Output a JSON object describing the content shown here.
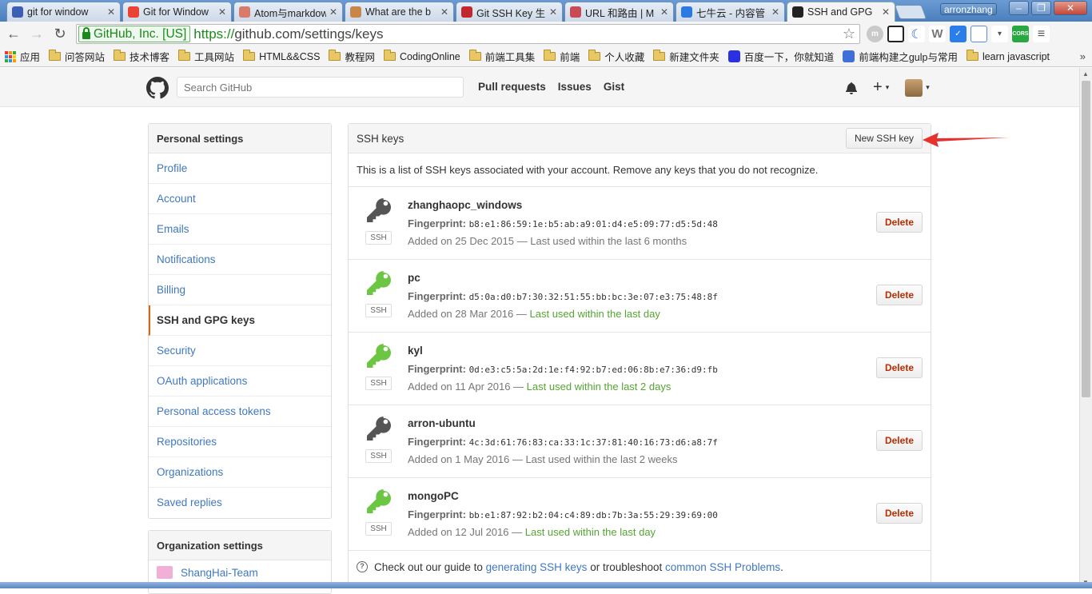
{
  "browser": {
    "tabs": [
      {
        "title": "git for window",
        "fav_color": "#3a5fb4"
      },
      {
        "title": "Git for Window",
        "fav_color": "#ea4335"
      },
      {
        "title": "Atom与markdown",
        "fav_color": "#d97b6a"
      },
      {
        "title": "What are the b",
        "fav_color": "#c9864a"
      },
      {
        "title": "Git SSH Key 生",
        "fav_color": "#c1272d"
      },
      {
        "title": "URL 和路由 | M",
        "fav_color": "#c84a55"
      },
      {
        "title": "七牛云 - 内容管",
        "fav_color": "#2a7ae2"
      },
      {
        "title": "SSH and GPG",
        "fav_color": "#222222"
      }
    ],
    "profile_name": "arronzhang",
    "url_ev_label": "GitHub, Inc. [US]",
    "url_scheme": "https://",
    "url_rest": "github.com/settings/keys",
    "bookmarks": [
      {
        "label": "应用",
        "type": "apps"
      },
      {
        "label": "问答网站",
        "type": "folder"
      },
      {
        "label": "技术博客",
        "type": "folder"
      },
      {
        "label": "工具网站",
        "type": "folder"
      },
      {
        "label": "HTML&&CSS",
        "type": "folder"
      },
      {
        "label": "教程网",
        "type": "folder"
      },
      {
        "label": "CodingOnline",
        "type": "folder"
      },
      {
        "label": "前端工具集",
        "type": "folder"
      },
      {
        "label": "前端",
        "type": "folder"
      },
      {
        "label": "个人收藏",
        "type": "folder"
      },
      {
        "label": "新建文件夹",
        "type": "folder"
      },
      {
        "label": "百度一下，你就知道",
        "type": "baidu"
      },
      {
        "label": "前端构建之gulp与常用",
        "type": "page"
      },
      {
        "label": "learn javascript",
        "type": "folder"
      }
    ],
    "bookmarks_more": "»"
  },
  "header": {
    "search_placeholder": "Search GitHub",
    "nav": [
      "Pull requests",
      "Issues",
      "Gist"
    ],
    "plus_label": "+",
    "caret": "▾"
  },
  "personal_settings": {
    "title": "Personal settings",
    "items": [
      "Profile",
      "Account",
      "Emails",
      "Notifications",
      "Billing",
      "SSH and GPG keys",
      "Security",
      "OAuth applications",
      "Personal access tokens",
      "Repositories",
      "Organizations",
      "Saved replies"
    ],
    "selected_index": 5
  },
  "organization_settings": {
    "title": "Organization settings",
    "orgs": [
      "ShangHai-Team"
    ]
  },
  "ssh": {
    "title": "SSH keys",
    "new_button": "New SSH key",
    "description": "This is a list of SSH keys associated with your account. Remove any keys that you do not recognize.",
    "badge": "SSH",
    "fingerprint_label": "Fingerprint:",
    "delete_label": "Delete",
    "keys": [
      {
        "title": "zhanghaopc_windows",
        "fingerprint": "b8:e1:86:59:1e:b5:ab:a9:01:d4:e5:09:77:d5:5d:48",
        "added": "Added on 25 Dec 2015 —",
        "last_used": "Last used within the last 6 months",
        "recent": false,
        "key_color": "#555555"
      },
      {
        "title": "pc",
        "fingerprint": "d5:0a:d0:b7:30:32:51:55:bb:bc:3e:07:e3:75:48:8f",
        "added": "Added on 28 Mar 2016 —",
        "last_used": "Last used within the last day",
        "recent": true,
        "key_color": "#6cc644"
      },
      {
        "title": "kyl",
        "fingerprint": "0d:e3:c5:5a:2d:1e:f4:92:b7:ed:06:8b:e7:36:d9:fb",
        "added": "Added on 11 Apr 2016 —",
        "last_used": "Last used within the last 2 days",
        "recent": true,
        "key_color": "#6cc644"
      },
      {
        "title": "arron-ubuntu",
        "fingerprint": "4c:3d:61:76:83:ca:33:1c:37:81:40:16:73:d6:a8:7f",
        "added": "Added on 1 May 2016 —",
        "last_used": "Last used within the last 2 weeks",
        "recent": false,
        "key_color": "#555555"
      },
      {
        "title": "mongoPC",
        "fingerprint": "bb:e1:87:92:b2:04:c4:89:db:7b:3a:55:29:39:69:00",
        "added": "Added on 12 Jul 2016 —",
        "last_used": "Last used within the last day",
        "recent": true,
        "key_color": "#6cc644"
      }
    ],
    "footer_prefix": "Check out our guide to",
    "footer_link1": "generating SSH keys",
    "footer_mid": "or troubleshoot",
    "footer_link2": "common SSH Problems",
    "footer_suffix": "."
  },
  "colors": {
    "link": "#4078c0",
    "recent": "#55a532",
    "danger": "#bd2c00",
    "annotation_arrow": "#e8312d"
  }
}
